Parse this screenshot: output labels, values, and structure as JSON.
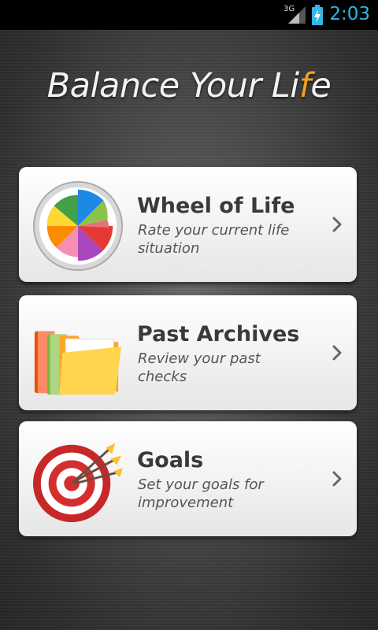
{
  "status_bar": {
    "network": "3G",
    "time": "2:03",
    "signal_icon": "cell-signal-icon",
    "battery_icon": "battery-charging-icon"
  },
  "app": {
    "title_main": "Balance Your Li",
    "title_accent": "f",
    "title_end": "e"
  },
  "menu": [
    {
      "title": "Wheel of Life",
      "subtitle": "Rate your current life situation",
      "icon": "wheel-of-life-icon"
    },
    {
      "title": "Past Archives",
      "subtitle": "Review your past checks",
      "icon": "folders-icon"
    },
    {
      "title": "Goals",
      "subtitle": "Set your goals for improvement",
      "icon": "target-icon"
    }
  ],
  "colors": {
    "status_accent": "#33b5e5",
    "title_accent": "#f0a020",
    "card_title": "#3a3a3a"
  }
}
